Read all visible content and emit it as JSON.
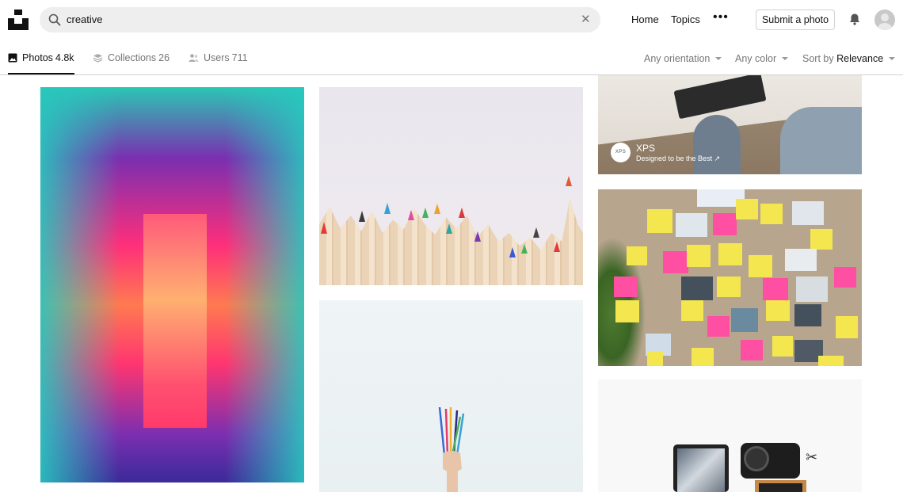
{
  "header": {
    "search": {
      "value": "creative"
    },
    "nav": {
      "home": "Home",
      "topics": "Topics",
      "more": "•••"
    },
    "submit_label": "Submit a photo"
  },
  "tabs": [
    {
      "label": "Photos",
      "count": "4.8k",
      "icon": "image-icon",
      "active": true
    },
    {
      "label": "Collections",
      "count": "26",
      "icon": "stack-icon",
      "active": false
    },
    {
      "label": "Users",
      "count": "711",
      "icon": "users-icon",
      "active": false
    }
  ],
  "filters": {
    "orientation": "Any orientation",
    "color": "Any color",
    "sort_prefix": "Sort by",
    "sort_value": "Relevance"
  },
  "sponsor": {
    "logo_text": "XPS",
    "name": "XPS",
    "tagline": "Designed to be the Best ↗"
  },
  "colors": {
    "text": "#111111",
    "muted": "#767676",
    "search_bg": "#eeeeee",
    "divider": "#d1d1d1"
  }
}
